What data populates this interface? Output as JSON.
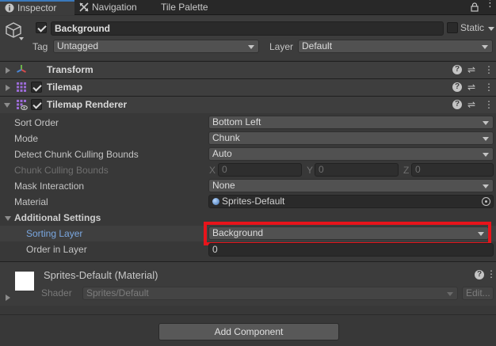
{
  "tabs": [
    {
      "label": "Inspector",
      "icon": "info-icon",
      "active": true
    },
    {
      "label": "Navigation",
      "icon": "navigation-icon",
      "active": false
    },
    {
      "label": "Tile Palette",
      "icon": "",
      "active": false
    }
  ],
  "gameobject": {
    "name": "Background",
    "active": true,
    "static_label": "Static",
    "tag_label": "Tag",
    "tag_value": "Untagged",
    "layer_label": "Layer",
    "layer_value": "Default"
  },
  "components": [
    {
      "title": "Transform",
      "icon": "transform-icon"
    },
    {
      "title": "Tilemap",
      "icon": "tilemap-icon"
    },
    {
      "title": "Tilemap Renderer",
      "icon": "tilemap-renderer-icon"
    }
  ],
  "renderer": {
    "sort_order_label": "Sort Order",
    "sort_order_value": "Bottom Left",
    "mode_label": "Mode",
    "mode_value": "Chunk",
    "detect_label": "Detect Chunk Culling Bounds",
    "detect_value": "Auto",
    "bounds_label": "Chunk Culling Bounds",
    "bounds_x_label": "X",
    "bounds_x": "0",
    "bounds_y_label": "Y",
    "bounds_y": "0",
    "bounds_z_label": "Z",
    "bounds_z": "0",
    "mask_label": "Mask Interaction",
    "mask_value": "None",
    "material_label": "Material",
    "material_value": "Sprites-Default",
    "additional_label": "Additional Settings",
    "sorting_layer_label": "Sorting Layer",
    "sorting_layer_value": "Background",
    "order_label": "Order in Layer",
    "order_value": "0"
  },
  "material_section": {
    "title": "Sprites-Default (Material)",
    "shader_label": "Shader",
    "shader_value": "Sprites/Default",
    "edit_label": "Edit..."
  },
  "add_component_label": "Add Component",
  "colors": {
    "highlight": "#e8141b",
    "active_tab": "#3a79bb",
    "label_blue": "#7aa7e0"
  }
}
